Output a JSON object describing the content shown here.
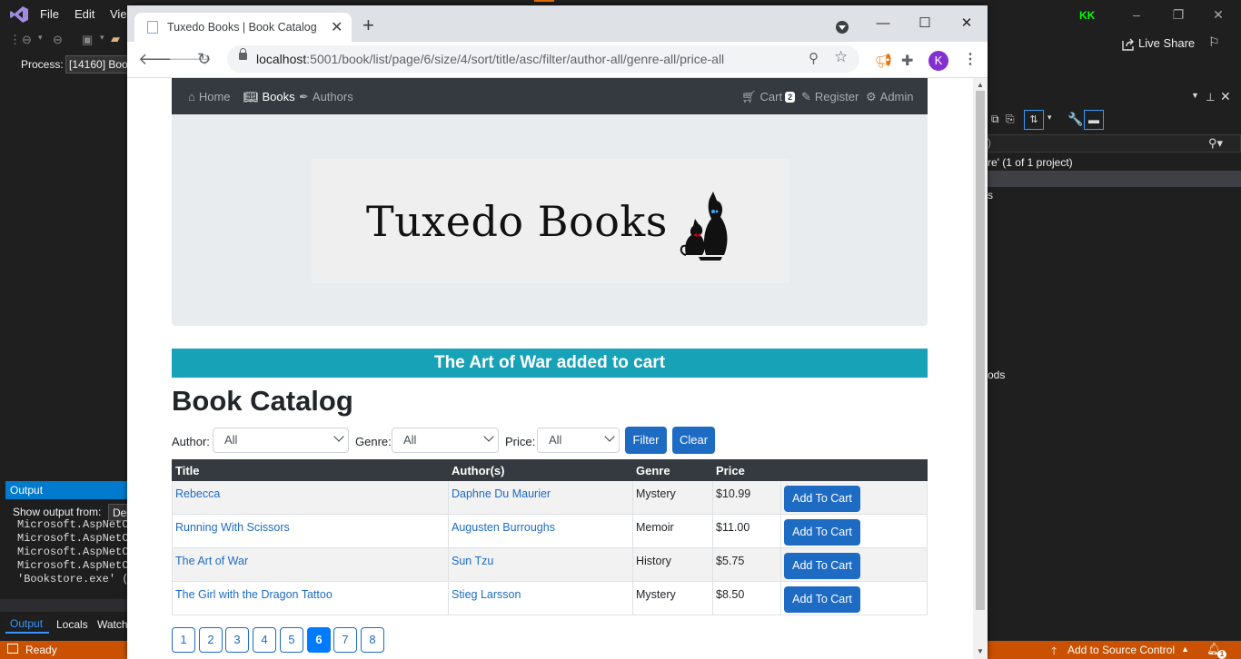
{
  "vs": {
    "menu": [
      "File",
      "Edit",
      "Vie"
    ],
    "user_initials": "KK",
    "process_label": "Process:",
    "process_value": "[14160] Boo",
    "live_share": "Live Share",
    "solution_item": "re' (1 of 1 project)",
    "item_s": "s",
    "item_ods": "ods",
    "output": {
      "title": "Output",
      "show_from": "Show output from:",
      "source": "De",
      "lines": [
        "Microsoft.AspNetC",
        "Microsoft.AspNetC",
        "Microsoft.AspNetC",
        "Microsoft.AspNetC",
        "'Bookstore.exe' ("
      ],
      "tabs": [
        "Output",
        "Locals",
        "Watch"
      ]
    },
    "status": {
      "ready": "Ready",
      "source_control": "Add to Source Control",
      "notification_count": "1"
    }
  },
  "browser": {
    "tab_title": "Tuxedo Books | Book Catalog",
    "url_host": "localhost",
    "url_path": ":5001/book/list/page/6/size/4/sort/title/asc/filter/author-all/genre-all/price-all",
    "profile_initial": "K"
  },
  "site": {
    "nav": {
      "home": "Home",
      "books": "Books",
      "authors": "Authors",
      "cart": "Cart",
      "cart_count": "2",
      "register": "Register",
      "admin": "Admin"
    },
    "logo_text": "Tuxedo Books",
    "alert": "The Art of War added to cart",
    "page_title": "Book Catalog",
    "filters": {
      "author_label": "Author:",
      "author_value": "All",
      "genre_label": "Genre:",
      "genre_value": "All",
      "price_label": "Price:",
      "price_value": "All",
      "filter_button": "Filter",
      "clear_button": "Clear"
    },
    "table": {
      "headers": [
        "Title",
        "Author(s)",
        "Genre",
        "Price"
      ],
      "rows": [
        {
          "title": "Rebecca",
          "author": "Daphne Du Maurier",
          "genre": "Mystery",
          "price": "$10.99",
          "button": "Add To Cart"
        },
        {
          "title": "Running With Scissors",
          "author": "Augusten Burroughs",
          "genre": "Memoir",
          "price": "$11.00",
          "button": "Add To Cart"
        },
        {
          "title": "The Art of War",
          "author": "Sun Tzu",
          "genre": "History",
          "price": "$5.75",
          "button": "Add To Cart"
        },
        {
          "title": "The Girl with the Dragon Tattoo",
          "author": "Stieg Larsson",
          "genre": "Mystery",
          "price": "$8.50",
          "button": "Add To Cart"
        }
      ]
    },
    "pages": [
      "1",
      "2",
      "3",
      "4",
      "5",
      "6",
      "7",
      "8"
    ],
    "current_page": "6"
  },
  "colors": {
    "vs_background": "#1f1f1f",
    "vs_status": "#ca5100",
    "vs_accent": "#007acc",
    "nav_dark": "#343a40",
    "alert_teal": "#17a2b8",
    "primary_blue": "#1e6bc4",
    "active_page": "#007bff"
  }
}
